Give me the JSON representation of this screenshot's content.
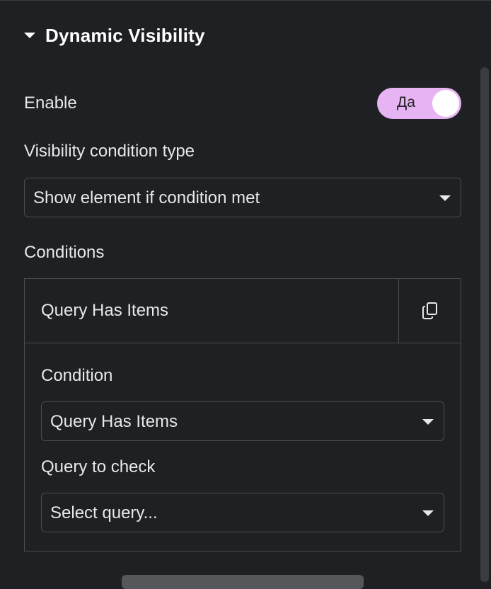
{
  "section": {
    "title": "Dynamic Visibility"
  },
  "enable": {
    "label": "Enable",
    "toggle_text": "Да"
  },
  "visibility": {
    "label": "Visibility condition type",
    "selected": "Show element if condition met"
  },
  "conditions": {
    "label": "Conditions",
    "item": {
      "title": "Query Has Items",
      "condition_label": "Condition",
      "condition_selected": "Query Has Items",
      "query_label": "Query to check",
      "query_selected": "Select query..."
    }
  },
  "colors": {
    "background": "#1f2023",
    "toggle_on": "#e6b3f3",
    "border": "#4a4c50"
  },
  "icons": {
    "section": "caret-down-icon",
    "duplicate": "copy-icon",
    "select": "caret-down-icon"
  }
}
